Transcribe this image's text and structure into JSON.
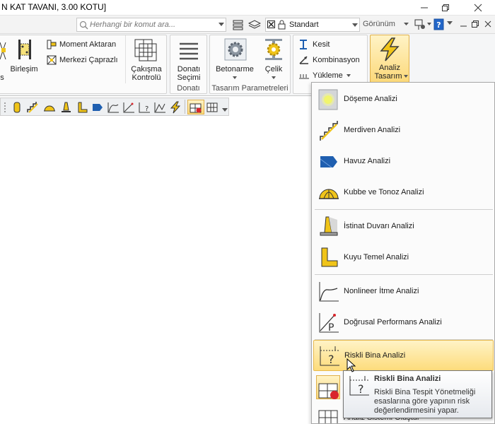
{
  "window": {
    "title": "N KAT TAVANI,  3.00 KOTU]"
  },
  "toolbar": {
    "search_placeholder": "Herhangi bir komut ara...",
    "style_value": "Standart",
    "view_label": "Görünüm"
  },
  "ribbon": {
    "partial_left_label": "s",
    "birlesim_label": "Birleşim",
    "moment_aktaran_label": "Moment Aktaran",
    "merkezi_caprazli_label": "Merkezi Çaprazlı",
    "cakisma_label_1": "Çakışma",
    "cakisma_label_2": "Kontrolü",
    "donati_secimi_label_1": "Donatı",
    "donati_secimi_label_2": "Seçimi",
    "donati_group_label": "Donatı",
    "betonarme_label": "Betonarme",
    "celik_label": "Çelik",
    "tasarim_group_label": "Tasarım Parametreleri",
    "kesit_label": "Kesit",
    "kombinasyon_label": "Kombinasyon",
    "yukleme_label": "Yükleme",
    "analiz_label_1": "Analiz",
    "analiz_label_2": "Tasarım"
  },
  "menu": {
    "items": [
      {
        "label": "Döşeme Analizi"
      },
      {
        "label": "Merdiven Analizi"
      },
      {
        "label": "Havuz Analizi"
      },
      {
        "label": "Kubbe ve Tonoz Analizi"
      },
      {
        "label": "İstinat Duvarı Analizi"
      },
      {
        "label": "Kuyu Temel Analizi"
      },
      {
        "label": "Nonlineer İtme Analizi"
      },
      {
        "label": "Doğrusal Performans Analizi"
      },
      {
        "label": "Riskli Bina Analizi"
      },
      {
        "label": "Analiz Sistemi Oluştur"
      }
    ]
  },
  "tooltip": {
    "title": "Riskli Bina Analizi",
    "description": "Riskli Bina Tespit Yönetmeliği esaslarına göre yapının risk değerlendirmesini yapar."
  },
  "colors": {
    "accent_yellow": "#f0c419",
    "highlight_top": "#fff3c6",
    "highlight_bottom": "#fddc7c",
    "blue_icon": "#1f5fb0",
    "red_icon": "#d9262c"
  }
}
